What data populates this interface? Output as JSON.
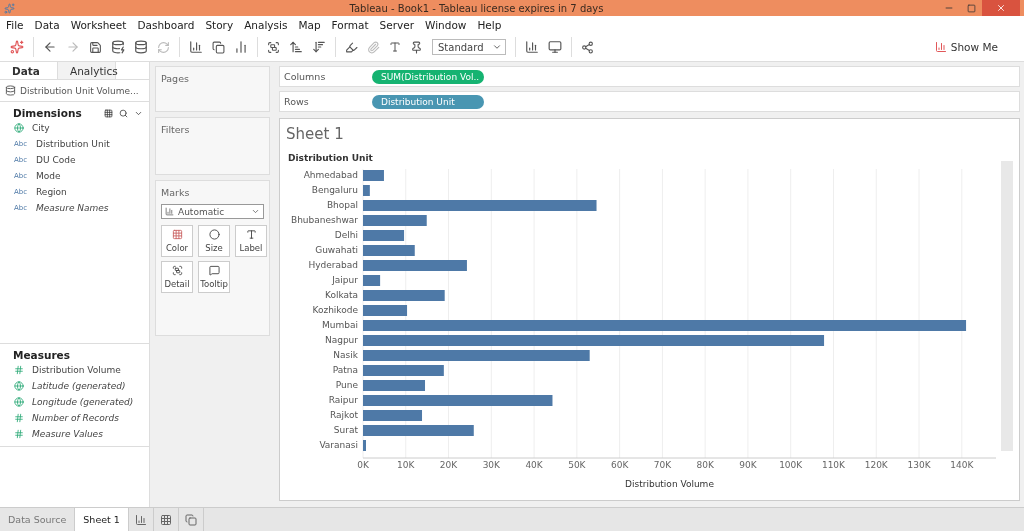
{
  "window": {
    "title": "Tableau - Book1 - Tableau license expires in 7 days"
  },
  "menu": [
    "File",
    "Data",
    "Worksheet",
    "Dashboard",
    "Story",
    "Analysis",
    "Map",
    "Format",
    "Server",
    "Window",
    "Help"
  ],
  "toolbar": {
    "fit": "Standard",
    "show_me": "Show Me"
  },
  "left_tabs": [
    {
      "label": "Data",
      "selected": true
    },
    {
      "label": "Analytics",
      "selected": false
    }
  ],
  "data_source": "Distribution Unit Volume...",
  "dimensions": {
    "title": "Dimensions",
    "items": [
      {
        "label": "City",
        "kind": "geo",
        "italic": false
      },
      {
        "label": "Distribution Unit",
        "kind": "text",
        "type_tag": "Abc",
        "italic": false
      },
      {
        "label": "DU Code",
        "kind": "text",
        "type_tag": "Abc",
        "italic": false
      },
      {
        "label": "Mode",
        "kind": "text",
        "type_tag": "Abc",
        "italic": false
      },
      {
        "label": "Region",
        "kind": "text",
        "type_tag": "Abc",
        "italic": false
      },
      {
        "label": "Measure Names",
        "kind": "text",
        "type_tag": "Abc",
        "italic": true
      }
    ]
  },
  "measures": {
    "title": "Measures",
    "items": [
      {
        "label": "Distribution Volume",
        "kind": "number",
        "italic": false
      },
      {
        "label": "Latitude (generated)",
        "kind": "geo",
        "italic": true
      },
      {
        "label": "Longitude (generated)",
        "kind": "geo",
        "italic": true
      },
      {
        "label": "Number of Records",
        "kind": "number",
        "italic": true
      },
      {
        "label": "Measure Values",
        "kind": "number",
        "italic": true
      }
    ]
  },
  "pages": {
    "title": "Pages"
  },
  "filters": {
    "title": "Filters"
  },
  "marks": {
    "title": "Marks",
    "type": "Automatic",
    "buttons": [
      {
        "label": "Color",
        "kind": "color"
      },
      {
        "label": "Size",
        "kind": "size"
      },
      {
        "label": "Label",
        "kind": "label"
      },
      {
        "label": "Detail",
        "kind": "detail"
      },
      {
        "label": "Tooltip",
        "kind": "tooltip"
      }
    ]
  },
  "shelves": [
    {
      "label": "Columns",
      "pill": "SUM(Distribution Vol..",
      "kind": "measure"
    },
    {
      "label": "Rows",
      "pill": "Distribution Unit",
      "kind": "dimension"
    }
  ],
  "sheet": {
    "title": "Sheet 1",
    "chart_data": {
      "type": "bar",
      "orientation": "horizontal",
      "ylabel": "Distribution Unit",
      "xlabel": "Distribution Volume",
      "categories": [
        "Ahmedabad",
        "Bengaluru",
        "Bhopal",
        "Bhubaneshwar",
        "Delhi",
        "Guwahati",
        "Hyderabad",
        "Jaipur",
        "Kolkata",
        "Kozhikode",
        "Mumbai",
        "Nagpur",
        "Nasik",
        "Patna",
        "Pune",
        "Raipur",
        "Rajkot",
        "Surat",
        "Varanasi"
      ],
      "grid": true,
      "series": [
        {
          "color": "#4e79a7",
          "values": [
            4900,
            1600,
            54600,
            14900,
            9600,
            12100,
            24300,
            4000,
            19100,
            10300,
            141000,
            107800,
            53000,
            18900,
            14500,
            44300,
            13800,
            25900,
            700
          ]
        }
      ],
      "xlim": [
        0,
        148000
      ],
      "xticks": [
        {
          "value": 0,
          "label": "0K"
        },
        {
          "value": 10000,
          "label": "10K"
        },
        {
          "value": 20000,
          "label": "20K"
        },
        {
          "value": 30000,
          "label": "30K"
        },
        {
          "value": 40000,
          "label": "40K"
        },
        {
          "value": 50000,
          "label": "50K"
        },
        {
          "value": 60000,
          "label": "60K"
        },
        {
          "value": 70000,
          "label": "70K"
        },
        {
          "value": 80000,
          "label": "80K"
        },
        {
          "value": 90000,
          "label": "90K"
        },
        {
          "value": 100000,
          "label": "100K"
        },
        {
          "value": 110000,
          "label": "110K"
        },
        {
          "value": 120000,
          "label": "120K"
        },
        {
          "value": 130000,
          "label": "130K"
        },
        {
          "value": 140000,
          "label": "140K"
        }
      ]
    }
  },
  "sheet_tabs": [
    {
      "label": "Data Source",
      "selected": false
    },
    {
      "label": "Sheet 1",
      "selected": true
    }
  ]
}
